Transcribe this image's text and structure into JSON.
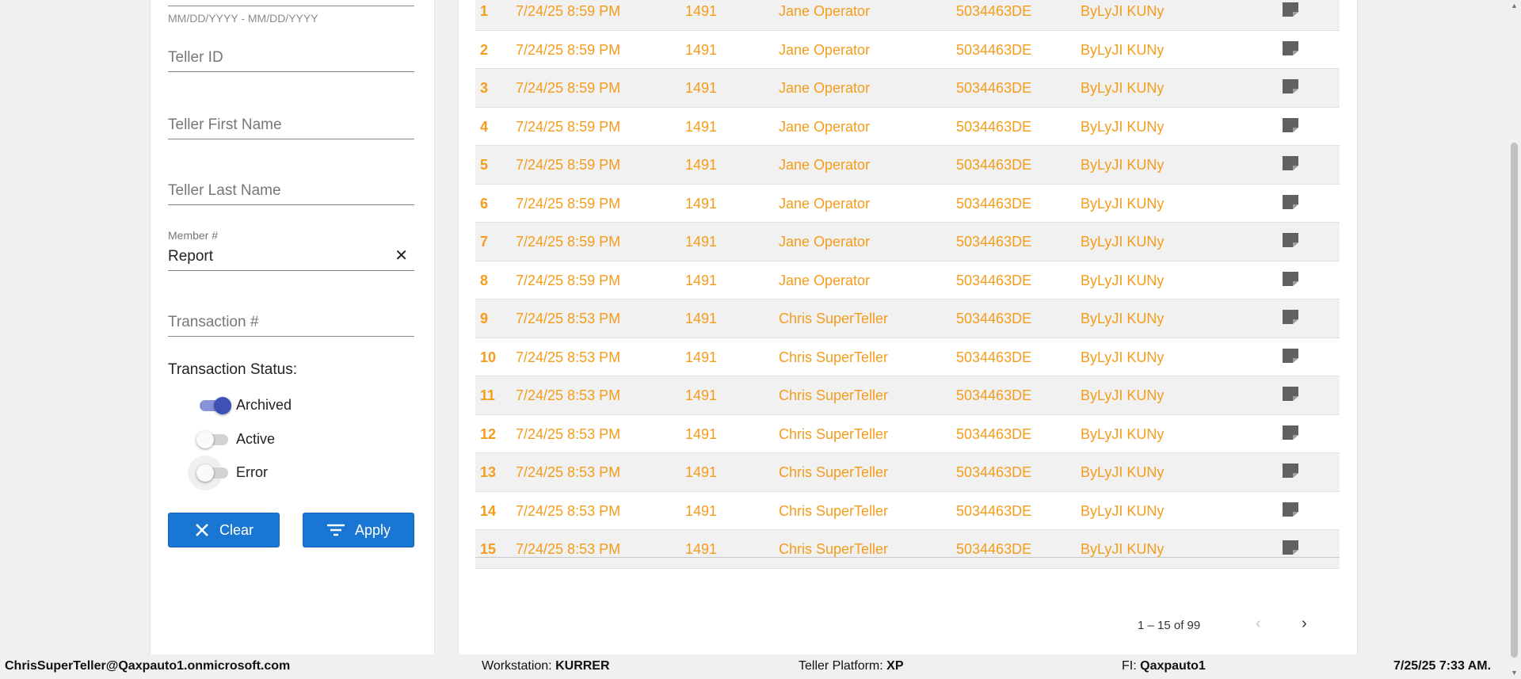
{
  "filters": {
    "date_range_hint": "MM/DD/YYYY - MM/DD/YYYY",
    "teller_id_placeholder": "Teller ID",
    "teller_first_name_placeholder": "Teller First Name",
    "teller_last_name_placeholder": "Teller Last Name",
    "member_label": "Member #",
    "member_value": "Report",
    "transaction_placeholder": "Transaction #",
    "status_title": "Transaction Status:",
    "statuses": [
      {
        "label": "Archived",
        "on": true
      },
      {
        "label": "Active",
        "on": false
      },
      {
        "label": "Error",
        "on": false
      }
    ],
    "clear_label": "Clear",
    "apply_label": "Apply"
  },
  "table": {
    "rows": [
      {
        "num": "1",
        "date": "7/24/25 8:59 PM",
        "code": "1491",
        "operator": "Jane Operator",
        "account": "5034463DE",
        "name": "ByLyJI KUNy"
      },
      {
        "num": "2",
        "date": "7/24/25 8:59 PM",
        "code": "1491",
        "operator": "Jane Operator",
        "account": "5034463DE",
        "name": "ByLyJI KUNy"
      },
      {
        "num": "3",
        "date": "7/24/25 8:59 PM",
        "code": "1491",
        "operator": "Jane Operator",
        "account": "5034463DE",
        "name": "ByLyJI KUNy"
      },
      {
        "num": "4",
        "date": "7/24/25 8:59 PM",
        "code": "1491",
        "operator": "Jane Operator",
        "account": "5034463DE",
        "name": "ByLyJI KUNy"
      },
      {
        "num": "5",
        "date": "7/24/25 8:59 PM",
        "code": "1491",
        "operator": "Jane Operator",
        "account": "5034463DE",
        "name": "ByLyJI KUNy"
      },
      {
        "num": "6",
        "date": "7/24/25 8:59 PM",
        "code": "1491",
        "operator": "Jane Operator",
        "account": "5034463DE",
        "name": "ByLyJI KUNy"
      },
      {
        "num": "7",
        "date": "7/24/25 8:59 PM",
        "code": "1491",
        "operator": "Jane Operator",
        "account": "5034463DE",
        "name": "ByLyJI KUNy"
      },
      {
        "num": "8",
        "date": "7/24/25 8:59 PM",
        "code": "1491",
        "operator": "Jane Operator",
        "account": "5034463DE",
        "name": "ByLyJI KUNy"
      },
      {
        "num": "9",
        "date": "7/24/25 8:53 PM",
        "code": "1491",
        "operator": "Chris SuperTeller",
        "account": "5034463DE",
        "name": "ByLyJI KUNy"
      },
      {
        "num": "10",
        "date": "7/24/25 8:53 PM",
        "code": "1491",
        "operator": "Chris SuperTeller",
        "account": "5034463DE",
        "name": "ByLyJI KUNy"
      },
      {
        "num": "11",
        "date": "7/24/25 8:53 PM",
        "code": "1491",
        "operator": "Chris SuperTeller",
        "account": "5034463DE",
        "name": "ByLyJI KUNy"
      },
      {
        "num": "12",
        "date": "7/24/25 8:53 PM",
        "code": "1491",
        "operator": "Chris SuperTeller",
        "account": "5034463DE",
        "name": "ByLyJI KUNy"
      },
      {
        "num": "13",
        "date": "7/24/25 8:53 PM",
        "code": "1491",
        "operator": "Chris SuperTeller",
        "account": "5034463DE",
        "name": "ByLyJI KUNy"
      },
      {
        "num": "14",
        "date": "7/24/25 8:53 PM",
        "code": "1491",
        "operator": "Chris SuperTeller",
        "account": "5034463DE",
        "name": "ByLyJI KUNy"
      },
      {
        "num": "15",
        "date": "7/24/25 8:53 PM",
        "code": "1491",
        "operator": "Chris SuperTeller",
        "account": "5034463DE",
        "name": "ByLyJI KUNy"
      }
    ],
    "row_icon": "note-icon",
    "text_color": "#f59c1a"
  },
  "pagination": {
    "range_text": "1 – 15 of 99",
    "prev_icon": "chevron-left-icon",
    "next_icon": "chevron-right-icon"
  },
  "status_bar": {
    "user": "ChrisSuperTeller@Qaxpauto1.onmicrosoft.com",
    "workstation_label": "Workstation:",
    "workstation_value": "KURRER",
    "platform_label": "Teller Platform:",
    "platform_value": "XP",
    "fi_label": "FI:",
    "fi_value": "Qaxpauto1",
    "datetime": "7/25/25 7:33 AM."
  },
  "colors": {
    "accent_button": "#1976d2",
    "toggle_on": "#3f51b5"
  }
}
